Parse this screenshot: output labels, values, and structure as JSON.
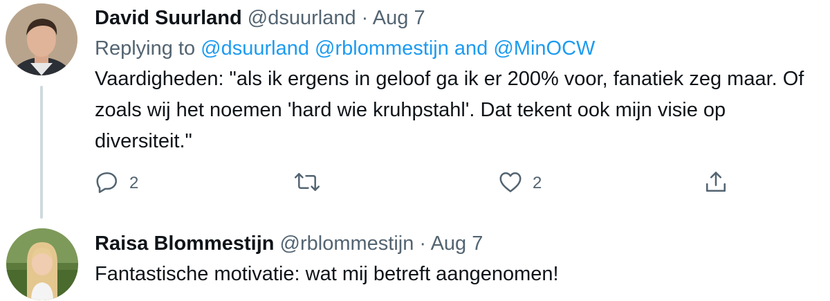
{
  "tweets": [
    {
      "name": "David Suurland",
      "handle": "@dsuurland",
      "separator": "·",
      "date": "Aug 7",
      "replying": {
        "prefix": "Replying to",
        "mention1": "@dsuurland",
        "mention2": "@rblommestijn",
        "and": "and",
        "mention3": "@MinOCW"
      },
      "text": "Vaardigheden: \"als ik ergens in geloof ga ik er 200% voor, fanatiek zeg maar. Of zoals wij het noemen 'hard wie kruhpstahl'. Dat tekent ook mijn visie op diversiteit.\"",
      "actions": {
        "reply_count": "2",
        "like_count": "2",
        "reply_icon": "reply-icon",
        "retweet_icon": "retweet-icon",
        "like_icon": "heart-icon",
        "share_icon": "share-icon"
      }
    },
    {
      "name": "Raisa Blommestijn",
      "handle": "@rblommestijn",
      "separator": "·",
      "date": "Aug 7",
      "text": "Fantastische motivatie: wat mij betreft aangenomen!"
    }
  ],
  "colors": {
    "text": "#0f1419",
    "secondary": "#536471",
    "mention": "#1d9bf0",
    "thread_line": "#cfd9de"
  }
}
